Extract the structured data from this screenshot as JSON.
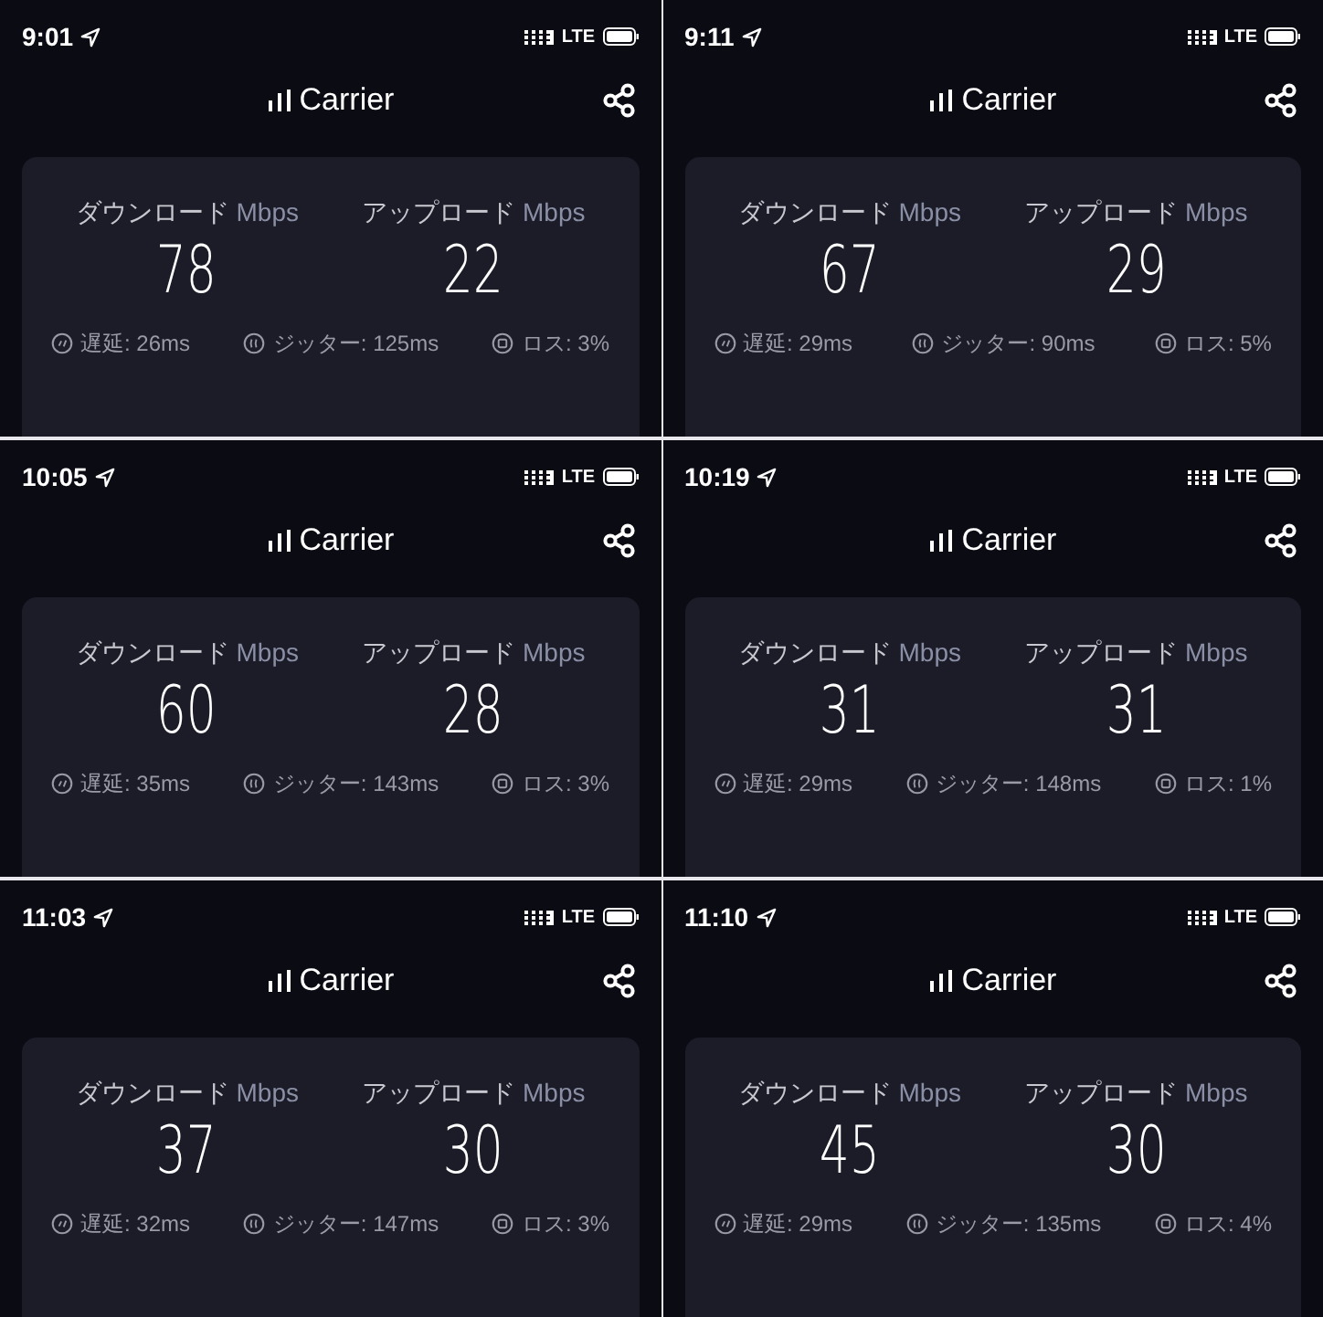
{
  "screens": [
    {
      "time": "9:01",
      "network": "LTE",
      "carrier": "Carrier",
      "download_label": "ダウンロード",
      "download_unit": "Mbps",
      "upload_label": "アップロード",
      "upload_unit": "Mbps",
      "download": "78",
      "upload": "22",
      "stats": [
        {
          "kind": "latency",
          "text": "遅延: 26ms"
        },
        {
          "kind": "jitter",
          "text": "ジッター: 125ms"
        },
        {
          "kind": "loss",
          "text": "ロス: 3%"
        }
      ]
    },
    {
      "time": "9:11",
      "network": "LTE",
      "carrier": "Carrier",
      "download_label": "ダウンロード",
      "download_unit": "Mbps",
      "upload_label": "アップロード",
      "upload_unit": "Mbps",
      "download": "67",
      "upload": "29",
      "stats": [
        {
          "kind": "latency",
          "text": "遅延: 29ms"
        },
        {
          "kind": "jitter",
          "text": "ジッター: 90ms"
        },
        {
          "kind": "loss",
          "text": "ロス: 5%"
        }
      ]
    },
    {
      "time": "10:05",
      "network": "LTE",
      "carrier": "Carrier",
      "download_label": "ダウンロード",
      "download_unit": "Mbps",
      "upload_label": "アップロード",
      "upload_unit": "Mbps",
      "download": "60",
      "upload": "28",
      "stats": [
        {
          "kind": "latency",
          "text": "遅延: 35ms"
        },
        {
          "kind": "jitter",
          "text": "ジッター: 143ms"
        },
        {
          "kind": "loss",
          "text": "ロス: 3%"
        }
      ]
    },
    {
      "time": "10:19",
      "network": "LTE",
      "carrier": "Carrier",
      "download_label": "ダウンロード",
      "download_unit": "Mbps",
      "upload_label": "アップロード",
      "upload_unit": "Mbps",
      "download": "31",
      "upload": "31",
      "stats": [
        {
          "kind": "latency",
          "text": "遅延: 29ms"
        },
        {
          "kind": "jitter",
          "text": "ジッター: 148ms"
        },
        {
          "kind": "loss",
          "text": "ロス: 1%"
        }
      ]
    },
    {
      "time": "11:03",
      "network": "LTE",
      "carrier": "Carrier",
      "download_label": "ダウンロード",
      "download_unit": "Mbps",
      "upload_label": "アップロード",
      "upload_unit": "Mbps",
      "download": "37",
      "upload": "30",
      "stats": [
        {
          "kind": "latency",
          "text": "遅延: 32ms"
        },
        {
          "kind": "jitter",
          "text": "ジッター: 147ms"
        },
        {
          "kind": "loss",
          "text": "ロス: 3%"
        }
      ]
    },
    {
      "time": "11:10",
      "network": "LTE",
      "carrier": "Carrier",
      "download_label": "ダウンロード",
      "download_unit": "Mbps",
      "upload_label": "アップロード",
      "upload_unit": "Mbps",
      "download": "45",
      "upload": "30",
      "stats": [
        {
          "kind": "latency",
          "text": "遅延: 29ms"
        },
        {
          "kind": "jitter",
          "text": "ジッター: 135ms"
        },
        {
          "kind": "loss",
          "text": "ロス: 4%"
        }
      ]
    }
  ]
}
